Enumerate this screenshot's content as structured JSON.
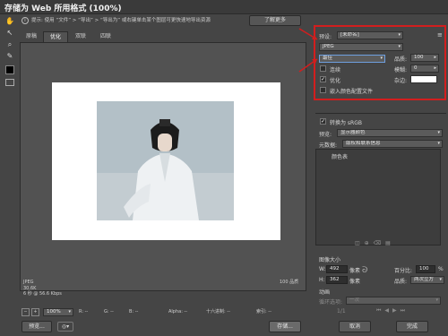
{
  "window": {
    "title": "存储为 Web 所用格式 (100%)"
  },
  "tips": {
    "text": "提示: 使用 “文件” > “导出” > “导出为” 或右键单击某个图层可更快速地导出资源",
    "learn_more": "了解更多"
  },
  "tabs": [
    "原稿",
    "优化",
    "双联",
    "四联"
  ],
  "canvas": {
    "zoom": "100%"
  },
  "info": {
    "format": "JPEG",
    "size": "30.6K",
    "time": "6 秒 @ 56.6 Kbps",
    "quality": "100 品质"
  },
  "statusbar": {
    "r": "R: --",
    "g": "G: --",
    "b": "B: --",
    "alpha": "Alpha: --",
    "hex": "十六进制: --",
    "index": "索引: --"
  },
  "panel": {
    "preset_label": "预设:",
    "preset_value": "[未命名]",
    "format_value": "JPEG",
    "quality_level": "最佳",
    "quality_label": "品质:",
    "quality_value": "100",
    "progressive": "连续",
    "blur_label": "模糊:",
    "blur_value": "0",
    "optimized": "优化",
    "matte_label": "杂边:",
    "embed_profile": "嵌入颜色配置文件",
    "convert_srgb": "转换为 sRGB",
    "preview_label": "预览:",
    "preview_value": "显示器颜色",
    "metadata_label": "元数据:",
    "metadata_value": "版权和联系信息",
    "color_table_title": "颜色表",
    "image_size_title": "图像大小",
    "w_label": "W:",
    "w_value": "492",
    "h_label": "H:",
    "h_value": "362",
    "px_unit": "像素",
    "percent_label": "百分比:",
    "percent_value": "100",
    "percent_unit": "%",
    "quality_label2": "品质:",
    "quality_value2": "两次立方",
    "animation_title": "动画",
    "loop_label": "循环选项:",
    "loop_value": "一次",
    "frame_counter": "1/1"
  },
  "buttons": {
    "preview": "预览...",
    "save": "存储...",
    "cancel": "取消",
    "done": "完成"
  }
}
